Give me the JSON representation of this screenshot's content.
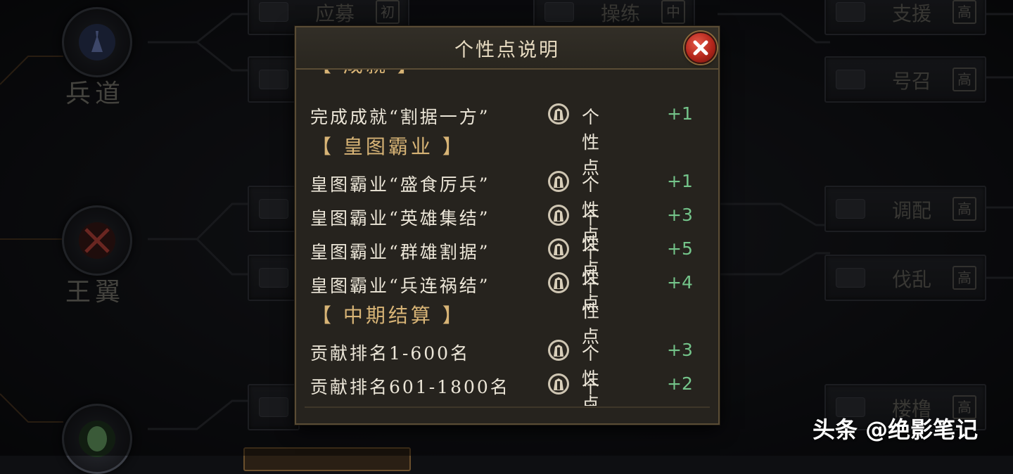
{
  "background": {
    "nodes": [
      {
        "name": "兵道",
        "icon": "soldier-icon",
        "color": "#5d6fa8"
      },
      {
        "name": "王翼",
        "icon": "crossed-swords-icon",
        "color": "#b23a34"
      },
      {
        "name": "",
        "icon": "leaf-icon",
        "color": "#5d9a5a"
      }
    ],
    "skills": [
      {
        "name": "应募",
        "grade": "初"
      },
      {
        "name": "操练",
        "grade": "中"
      },
      {
        "name": "支援",
        "grade": "高"
      },
      {
        "name": "号召",
        "grade": "高"
      },
      {
        "name": "调配",
        "grade": "高"
      },
      {
        "name": "伐乱",
        "grade": "高"
      },
      {
        "name": "楼橹",
        "grade": "高"
      }
    ]
  },
  "dialog": {
    "title": "个性点说明",
    "partial_section": "【 成就 】",
    "rows_group1": [
      {
        "text": "完成成就“割据一方”",
        "label": "个性点",
        "value": "+1"
      }
    ],
    "section2": "【 皇图霸业 】",
    "rows_group2": [
      {
        "text": "皇图霸业“盛食厉兵”",
        "label": "个性点",
        "value": "+1"
      },
      {
        "text": "皇图霸业“英雄集结”",
        "label": "个性点",
        "value": "+3"
      },
      {
        "text": "皇图霸业“群雄割据”",
        "label": "个性点",
        "value": "+5"
      },
      {
        "text": "皇图霸业“兵连祸结”",
        "label": "个性点",
        "value": "+4"
      }
    ],
    "section3": "【 中期结算 】",
    "rows_group3": [
      {
        "text": "贡献排名1-600名",
        "label": "个性点",
        "value": "+3"
      },
      {
        "text": "贡献排名601-1800名",
        "label": "个性点",
        "value": "+2"
      }
    ]
  },
  "watermark": "头条 @绝影笔记",
  "colors": {
    "value_green": "#74c48a",
    "section_gold": "#d8b476",
    "close_red": "#b3261b"
  }
}
